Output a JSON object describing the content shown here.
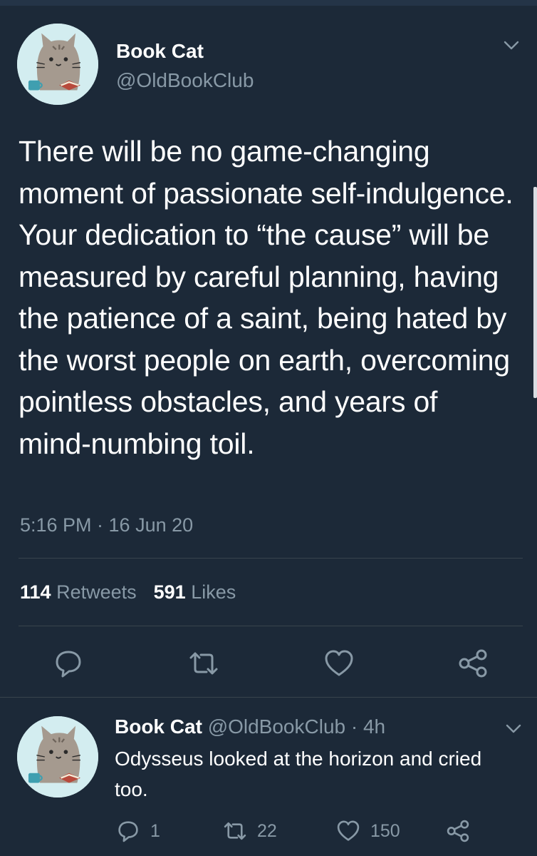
{
  "tweet": {
    "author_name": "Book Cat",
    "author_handle": "@OldBookClub",
    "text": "There will be no game-changing moment of passionate self-indulgence. Your dedication to “the cause” will be measured by careful planning, having the patience of a saint, being hated by the worst people on earth, overcoming pointless obstacles, and years of mind-numbing toil.",
    "timestamp": "5:16 PM · 16 Jun 20",
    "retweets_count": "114",
    "retweets_label": "Retweets",
    "likes_count": "591",
    "likes_label": "Likes"
  },
  "reply": {
    "author_name": "Book Cat",
    "author_handle": "@OldBookClub",
    "time_ago": "· 4h",
    "text": "Odysseus looked at the horizon and cried too.",
    "replies_count": "1",
    "retweets_count": "22",
    "likes_count": "150"
  },
  "icons": [
    "chevron-down-icon",
    "reply-icon",
    "retweet-icon",
    "like-icon",
    "share-icon"
  ],
  "colors": {
    "background": "#1c2938",
    "text_primary": "#ffffff",
    "text_secondary": "#8899a6",
    "divider": "#38444d"
  }
}
